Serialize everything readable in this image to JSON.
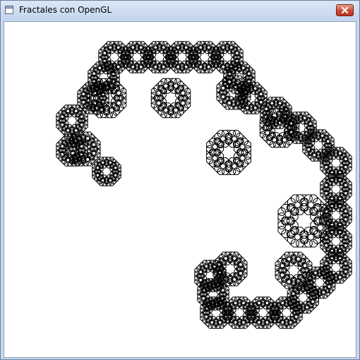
{
  "window": {
    "title": "Fractales con OpenGL",
    "app_icon": "window-icon",
    "close_icon": "close-icon",
    "close_button_color": "#c8432c"
  },
  "canvas": {
    "background": "#ffffff",
    "stroke": "#000000"
  }
}
